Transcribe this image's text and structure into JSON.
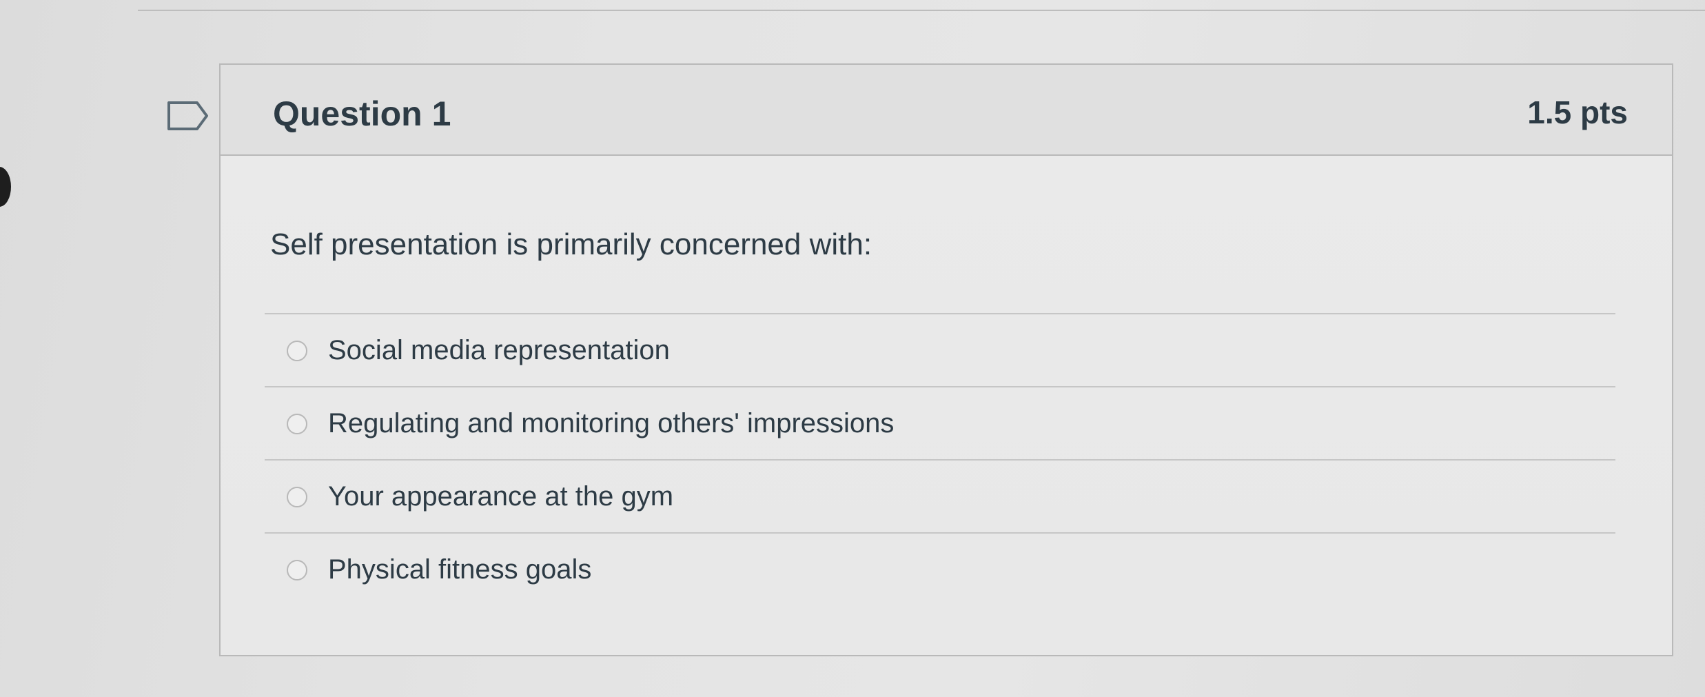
{
  "question": {
    "title": "Question 1",
    "points": "1.5 pts",
    "text": "Self presentation is primarily concerned with:",
    "answers": [
      {
        "label": "Social media representation",
        "selected": false
      },
      {
        "label": "Regulating and monitoring others' impressions",
        "selected": false
      },
      {
        "label": "Your appearance at the gym",
        "selected": false
      },
      {
        "label": "Physical fitness goals",
        "selected": false
      }
    ]
  },
  "icons": {
    "flag": "flag-question-icon"
  },
  "colors": {
    "text": "#2d3b45",
    "border": "#b9b9b9",
    "background": "#e4e4e4"
  }
}
